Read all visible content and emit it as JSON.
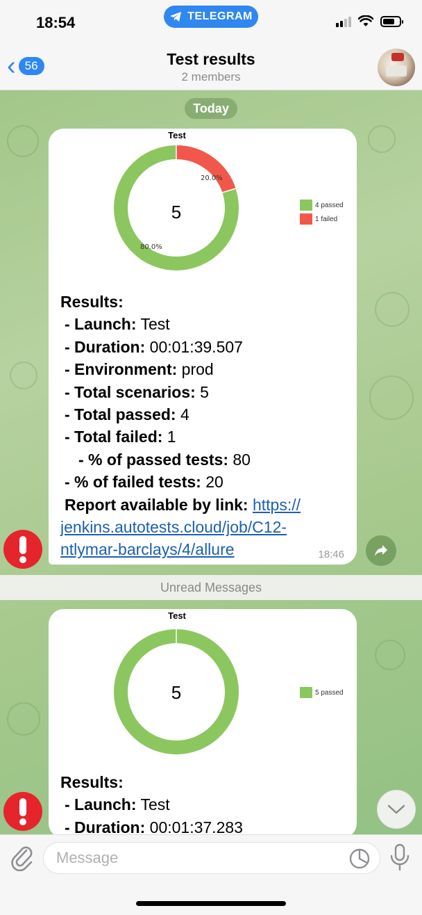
{
  "status_bar": {
    "time": "18:54",
    "banner": "TELEGRAM"
  },
  "header": {
    "back_count": "56",
    "title": "Test results",
    "subtitle": "2 members"
  },
  "date_pill": "Today",
  "messages": [
    {
      "chart": {
        "title": "Test",
        "center_value": "5",
        "slices": [
          {
            "label": "4 passed",
            "value": 4,
            "percent": "80.0%",
            "color": "#8cc65f"
          },
          {
            "label": "1 failed",
            "value": 1,
            "percent": "20.0%",
            "color": "#f2574b"
          }
        ]
      },
      "results": {
        "heading": "Results:",
        "launch_label": "- Launch:",
        "launch_value": "Test",
        "duration_label": "- Duration:",
        "duration_value": "00:01:39.507",
        "env_label": "- Environment:",
        "env_value": "prod",
        "scen_label": "- Total scenarios:",
        "scen_value": "5",
        "passed_label": "- Total passed:",
        "passed_value": "4",
        "failed_label": "- Total failed:",
        "failed_value": "1",
        "pct_passed_label": "- % of passed tests:",
        "pct_passed_value": "80",
        "pct_failed_label": "- % of failed tests:",
        "pct_failed_value": "20",
        "report_label": "Report available by link:",
        "link_line1": "https://",
        "link_line2": "jenkins.autotests.cloud/job/C12-",
        "link_line3": "ntlymar-barclays/4/allure"
      },
      "time": "18:46"
    },
    {
      "chart": {
        "title": "Test",
        "center_value": "5",
        "slices": [
          {
            "label": "5 passed",
            "value": 5,
            "color": "#8cc65f"
          }
        ]
      },
      "results": {
        "heading": "Results:",
        "launch_label": "- Launch:",
        "launch_value": "Test",
        "duration_label": "- Duration:",
        "duration_value": "00:01:37.283"
      }
    }
  ],
  "unread_separator": "Unread Messages",
  "input": {
    "placeholder": "Message"
  },
  "colors": {
    "accent": "#2f87f0",
    "alert": "#e6242c",
    "passed": "#8cc65f",
    "failed": "#f2574b"
  },
  "icons": [
    "telegram-plane-icon",
    "signal-icon",
    "wifi-icon",
    "battery-icon",
    "back-chevron-icon",
    "alert-icon",
    "share-icon",
    "chevron-down-icon",
    "paperclip-icon",
    "sticker-icon",
    "microphone-icon"
  ]
}
